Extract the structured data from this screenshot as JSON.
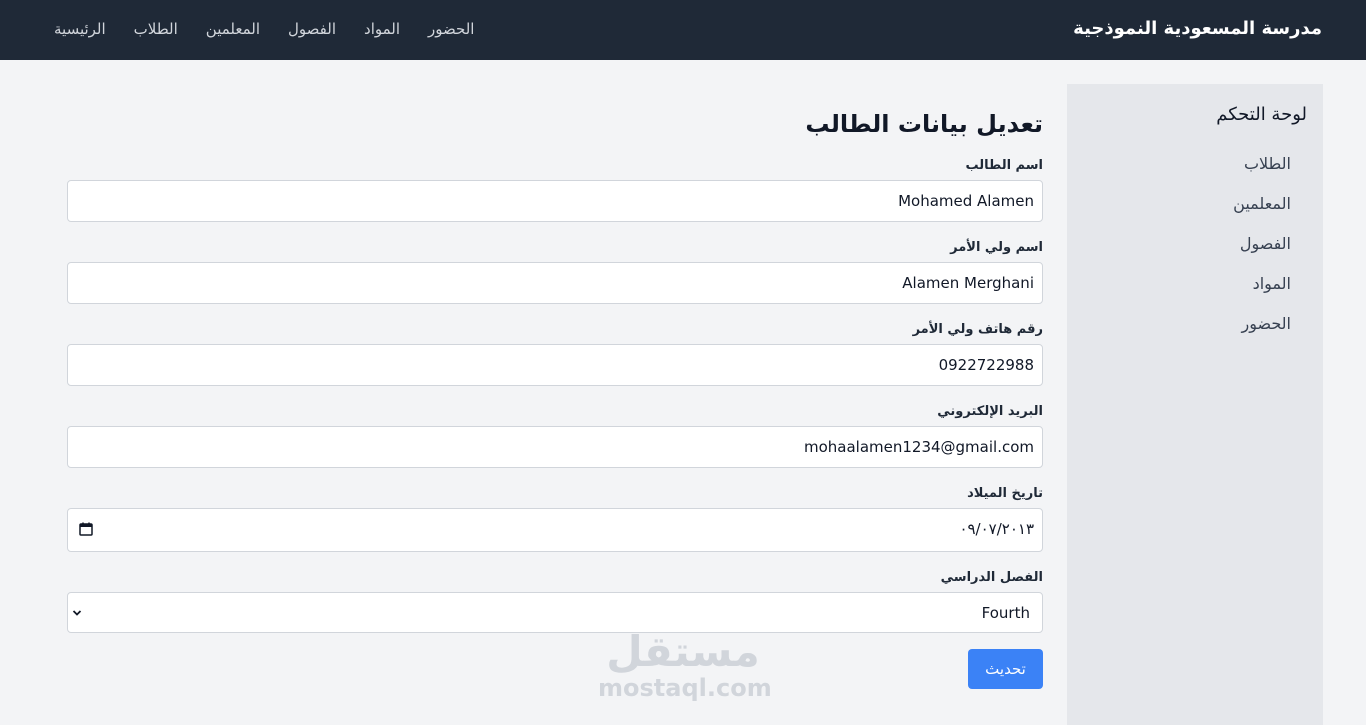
{
  "navbar": {
    "brand": "مدرسة المسعودية النموذجية",
    "links": [
      "الرئيسية",
      "الطلاب",
      "المعلمين",
      "الفصول",
      "المواد",
      "الحضور"
    ]
  },
  "sidebar": {
    "title": "لوحة التحكم",
    "items": [
      "الطلاب",
      "المعلمين",
      "الفصول",
      "المواد",
      "الحضور"
    ]
  },
  "form": {
    "title": "تعديل بيانات الطالب",
    "student_name": {
      "label": "اسم الطالب",
      "value": "Mohamed Alamen"
    },
    "guardian_name": {
      "label": "اسم ولي الأمر",
      "value": "Alamen Merghani"
    },
    "guardian_phone": {
      "label": "رقم هاتف ولي الأمر",
      "value": "0922722988"
    },
    "email": {
      "label": "البريد الإلكتروني",
      "value": "mohaalamen1234@gmail.com"
    },
    "birth_date": {
      "label": "تاريخ الميلاد",
      "value": "٠٩/٠٧/٢٠١٣"
    },
    "class": {
      "label": "الفصل الدراسي",
      "selected": "Fourth"
    },
    "submit_label": "تحديث"
  },
  "watermark": {
    "main": "مستقل",
    "sub": "mostaql.com"
  },
  "colors": {
    "navbar_bg": "#1f2937",
    "page_bg": "#f3f4f6",
    "sidebar_bg": "#e5e7eb",
    "accent": "#3b82f6"
  }
}
